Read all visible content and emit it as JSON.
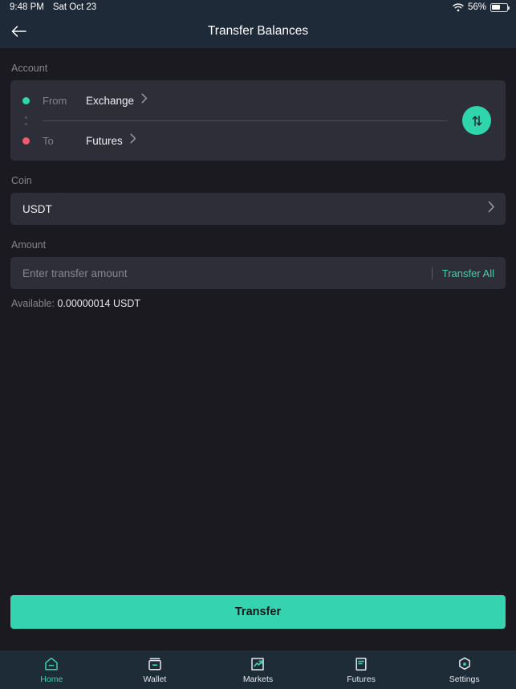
{
  "status_bar": {
    "time": "9:48 PM",
    "date": "Sat Oct 23",
    "battery_percent": "56%",
    "wifi_icon": "wifi-icon",
    "battery_icon": "battery-icon"
  },
  "header": {
    "title": "Transfer Balances",
    "back_icon": "arrow-left-icon"
  },
  "account": {
    "label": "Account",
    "from_key": "From",
    "from_value": "Exchange",
    "to_key": "To",
    "to_value": "Futures",
    "from_dot_color": "#2fd6ab",
    "to_dot_color": "#f4596a",
    "swap_icon": "swap-vertical-icon",
    "chevron_icon": "chevron-right-icon"
  },
  "coin": {
    "label": "Coin",
    "value": "USDT",
    "chevron_icon": "chevron-right-icon"
  },
  "amount": {
    "label": "Amount",
    "placeholder": "Enter transfer amount",
    "value": "",
    "transfer_all_label": "Transfer All",
    "available_label": "Available:",
    "available_value": "0.00000014 USDT"
  },
  "submit": {
    "label": "Transfer",
    "color": "#35d3b0"
  },
  "nav": {
    "active_color": "#3ed0ae",
    "items": [
      {
        "label": "Home",
        "icon": "home-icon",
        "active": true
      },
      {
        "label": "Wallet",
        "icon": "wallet-icon",
        "active": false
      },
      {
        "label": "Markets",
        "icon": "markets-chart-icon",
        "active": false
      },
      {
        "label": "Futures",
        "icon": "futures-document-icon",
        "active": false
      },
      {
        "label": "Settings",
        "icon": "settings-hexagon-icon",
        "active": false
      }
    ]
  }
}
